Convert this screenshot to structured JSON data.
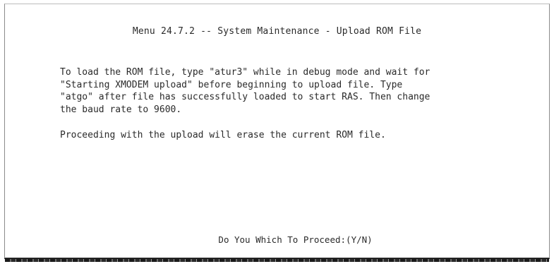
{
  "screen": {
    "title": "Menu 24.7.2 -- System Maintenance - Upload ROM File",
    "instructions": "To load the ROM file, type \"atur3\" while in debug mode and wait for\n\"Starting XMODEM upload\" before beginning to upload file. Type\n\"atgo\" after file has successfully loaded to start RAS. Then change\nthe baud rate to 9600.",
    "warning": "Proceeding with the upload will erase the current ROM file.",
    "prompt": "Do You Which To Proceed:(Y/N)"
  }
}
